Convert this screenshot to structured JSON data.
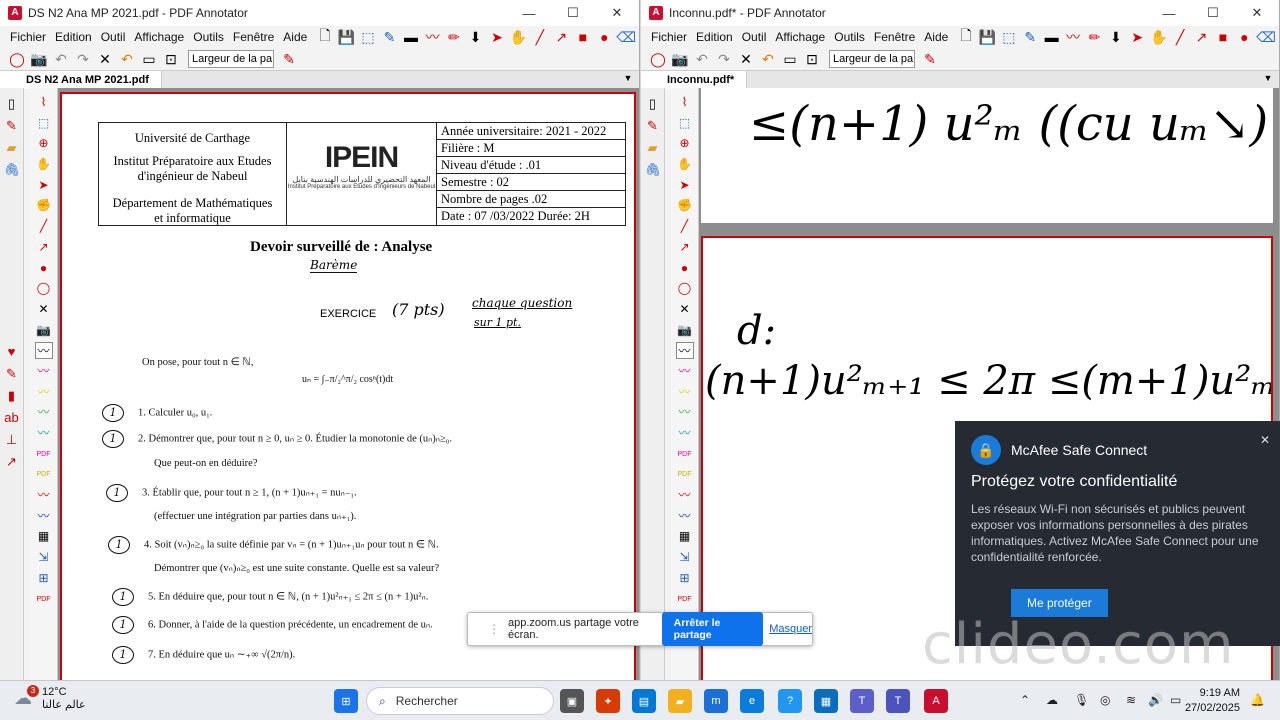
{
  "left_window": {
    "title": "DS N2 Ana MP 2021.pdf - PDF Annotator",
    "menu": [
      "Fichier",
      "Edition",
      "Outil",
      "Affichage",
      "Outils",
      "Fenêtre",
      "Aide"
    ],
    "zoom": "Largeur de la pa",
    "tab": "DS N2 Ana MP 2021.pdf",
    "doc": {
      "header_left": [
        "Université de Carthage",
        "Institut Préparatoire aux Etudes",
        "d'ingénieur de Nabeul",
        "Département de Mathématiques",
        "et informatique"
      ],
      "logo": "IPEIN",
      "logo_ar": "المعهد التحضيري للدراسات الهندسية بنابل",
      "logo_sub": "Institut Préparatoire aux Etudes d'Ingénieurs de Nabeul",
      "header_right": [
        "Année universitaire: 2021 - 2022",
        "Filière : M",
        "Niveau d'étude : .01",
        "Semestre : 02",
        "Nombre de pages .02",
        "Date : 07 /03/2022  Durée: 2H"
      ],
      "title": "Devoir surveillé de : Analyse",
      "bareme": "Barème",
      "exercise_label": "EXERCICE",
      "exercise_pts": "(7 pts)",
      "note": "chaque question",
      "note2": "sur 1 pt.",
      "intro": "On pose, pour tout n ∈ ℕ,",
      "formula": "uₙ = ∫₋π/₂^π/₂ cosⁿ(t)dt",
      "mark": "1",
      "questions": [
        "1.  Calculer u₀, u₁.",
        "2.  Démontrer que, pour tout n ≥ 0, uₙ ≥ 0. Étudier la monotonie de (uₙ)ₙ≥₀.",
        "Que peut-on en déduire?",
        "3.  Établir que, pour tout n ≥ 1, (n + 1)uₙ₊₁ = nuₙ₋₁.",
        "(effectuer une intégration par parties dans uₙ₊₁).",
        "4.  Soit (vₙ)ₙ≥₀ la suite définie par vₙ = (n + 1)uₙ₊₁uₙ pour tout n ∈ ℕ.",
        "Démontrer que (vₙ)ₙ≥₀ est une suite constante. Quelle est sa valeur?",
        "5.  En déduire que, pour tout n ∈ ℕ, (n + 1)u²ₙ₊₁ ≤ 2π ≤ (n + 1)u²ₙ.",
        "6.  Donner, à l'aide de la question précédente, un encadrement de uₙ.",
        "7.  En déduire que uₙ ∼₊∞ √(2π/n)."
      ]
    }
  },
  "right_window": {
    "title": "Inconnu.pdf* - PDF Annotator",
    "menu": [
      "Fichier",
      "Edition",
      "Outil",
      "Affichage",
      "Outils",
      "Fenêtre",
      "Aide"
    ],
    "zoom": "Largeur de la pa",
    "tab": "Inconnu.pdf*",
    "ink_top": "≤(n+1) u²ₘ ((cu   uₘ↘)",
    "ink_label": "d:",
    "ink_line": "(n+1)u²ₘ₊₁  ≤ 2π ≤(m+1)u²ₘ"
  },
  "share_bar": {
    "text": "app.zoom.us partage votre écran.",
    "stop": "Arrêter le partage",
    "hide": "Masquer"
  },
  "mcafee": {
    "brand": "McAfee Safe Connect",
    "title": "Protégez votre confidentialité",
    "body": "Les réseaux Wi-Fi non sécurisés et publics peuvent exposer vos informations personnelles à des pirates informatiques. Activez McAfee Safe Connect pour une confidentialité renforcée.",
    "button": "Me protéger"
  },
  "watermark": "clideo.com",
  "taskbar": {
    "temp": "12°C",
    "location": "عالم عالنا",
    "badge": "3",
    "search": "Rechercher",
    "time": "9:19 AM",
    "date": "27/02/2025"
  }
}
